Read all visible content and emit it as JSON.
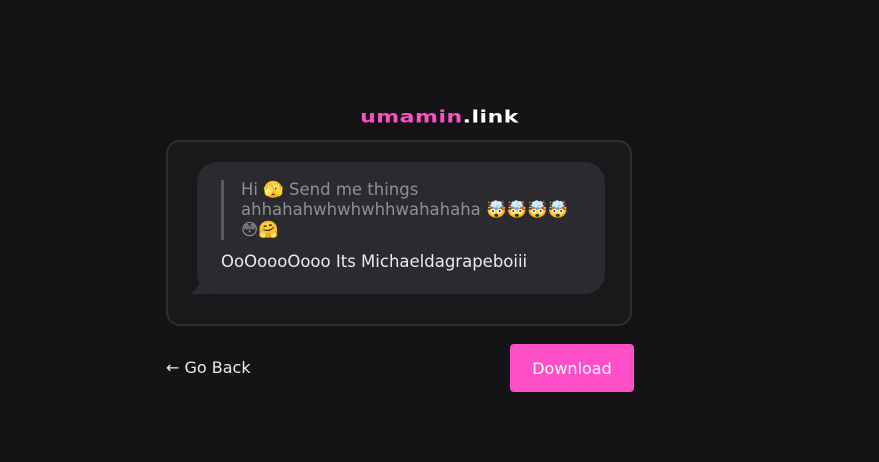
{
  "logo": {
    "brand": "umamin",
    "tld": ".link"
  },
  "card": {
    "quote_text": "Hi 🫣 Send me things ahhahahwhwhwhhwahahaha 🤯🤯🤯🤯😳🤗",
    "reply_text": "OoOoooOooo Its Michaeldagrapeboiii"
  },
  "actions": {
    "go_back_label": "← Go Back",
    "download_label": "Download"
  },
  "colors": {
    "accent": "#ff4fc8",
    "background": "#141416",
    "bubble": "#2b2b2f"
  }
}
